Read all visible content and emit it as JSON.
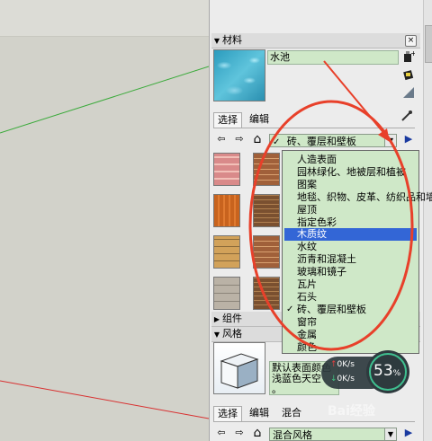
{
  "materials": {
    "title": "材料",
    "name_value": "水池",
    "tabs": [
      "选择",
      "编辑"
    ],
    "collection": "砖、覆层和壁板",
    "dropdown": {
      "items": [
        {
          "label": "人造表面",
          "checked": false,
          "selected": false
        },
        {
          "label": "园林绿化、地被层和植被",
          "checked": false,
          "selected": false
        },
        {
          "label": "图案",
          "checked": false,
          "selected": false
        },
        {
          "label": "地毯、织物、皮革、纺织品和墙纸",
          "checked": false,
          "selected": false
        },
        {
          "label": "屋顶",
          "checked": false,
          "selected": false
        },
        {
          "label": "指定色彩",
          "checked": false,
          "selected": false
        },
        {
          "label": "木质纹",
          "checked": false,
          "selected": true
        },
        {
          "label": "水纹",
          "checked": false,
          "selected": false
        },
        {
          "label": "沥青和混凝土",
          "checked": false,
          "selected": false
        },
        {
          "label": "玻璃和镜子",
          "checked": false,
          "selected": false
        },
        {
          "label": "瓦片",
          "checked": false,
          "selected": false
        },
        {
          "label": "石头",
          "checked": false,
          "selected": false
        },
        {
          "label": "砖、覆层和壁板",
          "checked": true,
          "selected": false
        },
        {
          "label": "窗帘",
          "checked": false,
          "selected": false
        },
        {
          "label": "金属",
          "checked": false,
          "selected": false
        },
        {
          "label": "颜色",
          "checked": false,
          "selected": false
        }
      ]
    }
  },
  "components": {
    "title": "组件"
  },
  "styles": {
    "title": "风格",
    "desc_line1": "默认表面颜色",
    "desc_line2": "浅蓝色天空",
    "desc_line3": "。",
    "tabs": [
      "选择",
      "编辑",
      "混合"
    ],
    "collection": "混合风格"
  },
  "gauge": {
    "percent": "53",
    "percent_unit": "%",
    "upload": "0K/s",
    "download": "0K/s"
  },
  "watermark": "Bai经验",
  "icons": {
    "checkmark": "✓",
    "back": "⇦",
    "forward": "⇨",
    "home": "⌂",
    "details": "▶",
    "collapse": "▼",
    "expand": "▶",
    "close": "×"
  },
  "colors": {
    "field_bg": "#cfe8c8",
    "selection": "#3366d6",
    "annotation": "#e8402a"
  }
}
